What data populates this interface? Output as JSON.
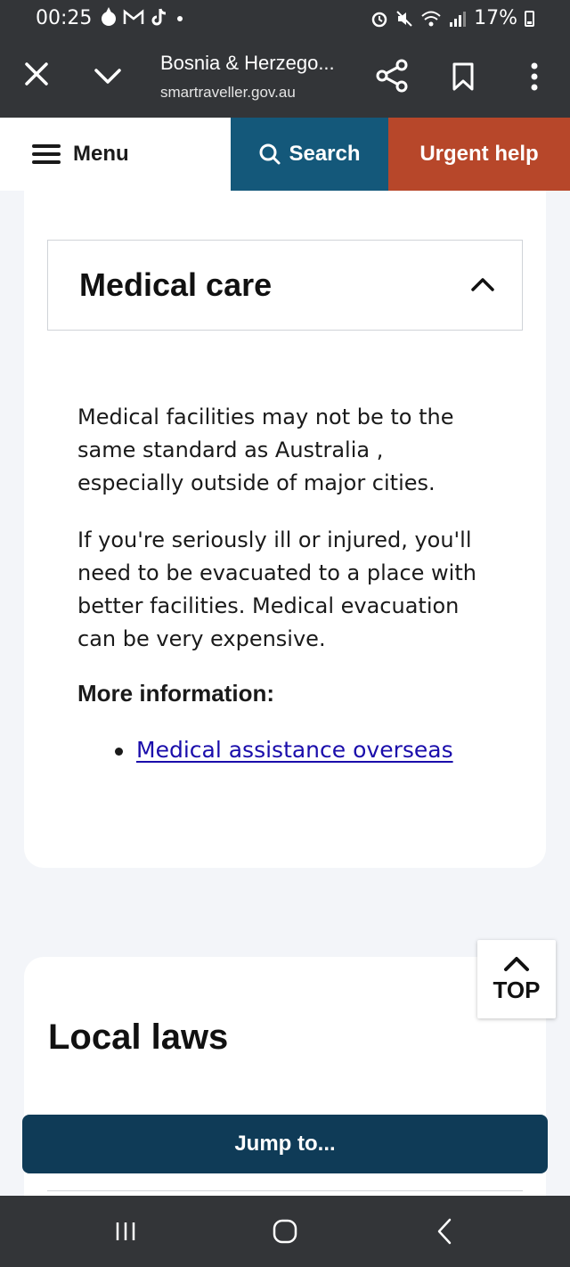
{
  "status_bar": {
    "time": "00:25",
    "battery": "17%",
    "left_icons": [
      "flame-icon",
      "gmail-icon",
      "tiktok-icon",
      "dot-icon"
    ],
    "right_icons": [
      "alarm-icon",
      "mute-icon",
      "wifi-icon",
      "signal-icon",
      "battery-icon"
    ]
  },
  "browser": {
    "title": "Bosnia & Herzego...",
    "url": "smartraveller.gov.au"
  },
  "site_nav": {
    "menu_label": "Menu",
    "search_label": "Search",
    "urgent_label": "Urgent help",
    "colors": {
      "search": "#14587a",
      "urgent": "#b7472a"
    }
  },
  "medical": {
    "title": "Medical care",
    "paragraphs": [
      "Medical facilities may not be to the same standard as Australia , especially outside of major cities.",
      "If you're seriously ill or injured, you'll need to be evacuated to a place with better facilities. Medical evacuation can be very expensive."
    ],
    "more_info_label": "More information:",
    "links": [
      "Medical assistance overseas"
    ]
  },
  "laws": {
    "title": "Local laws"
  },
  "top_button": {
    "label": "TOP"
  },
  "jump_button": {
    "label": "Jump to..."
  }
}
